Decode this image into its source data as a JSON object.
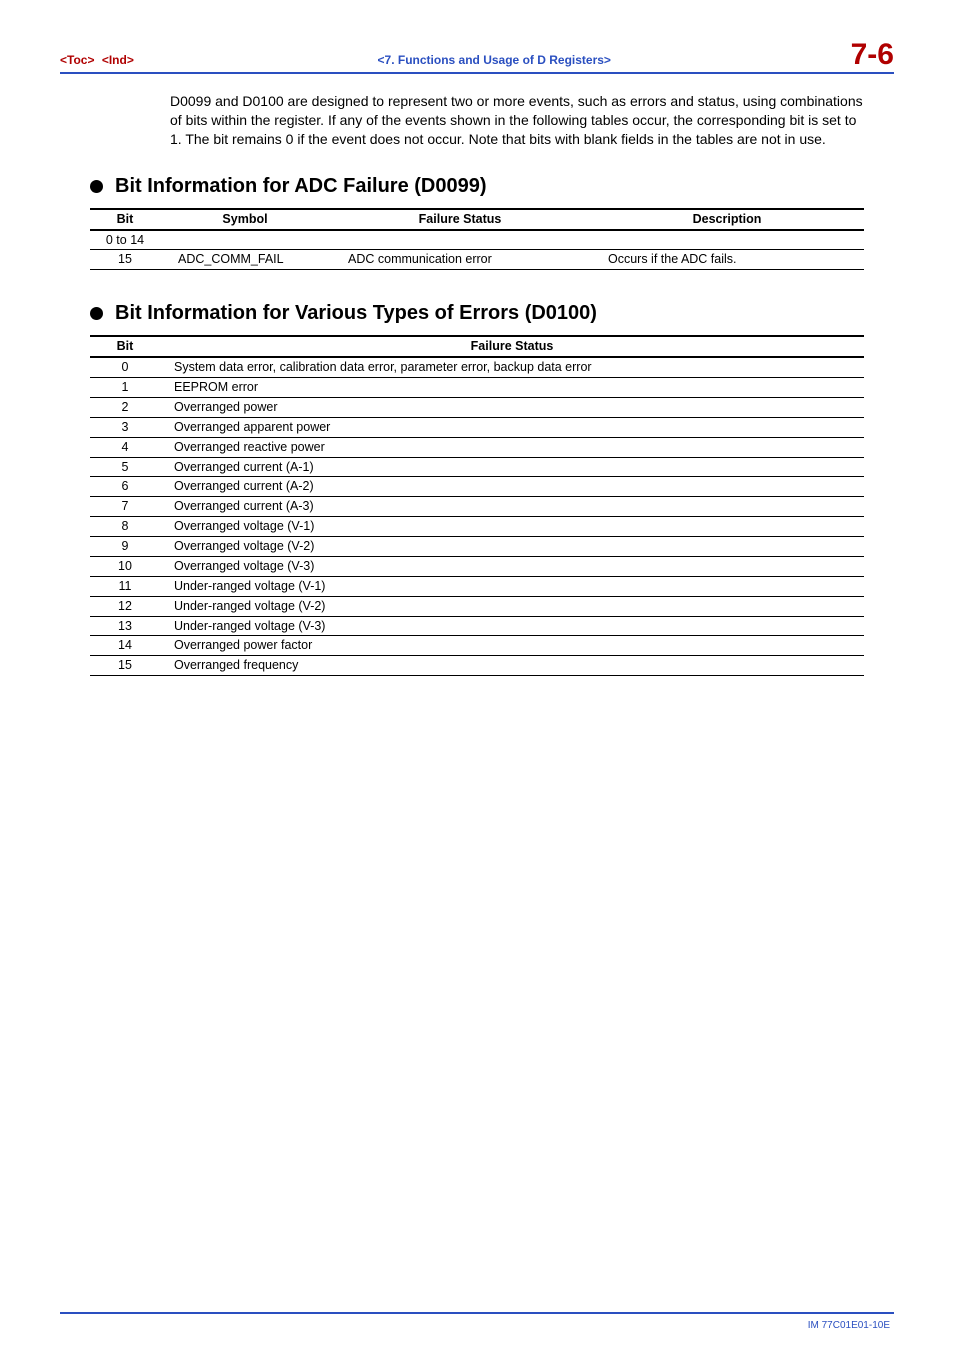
{
  "header": {
    "toc": "<Toc>",
    "ind": "<Ind>",
    "center": "<7.  Functions and Usage of D Registers>",
    "pageNum": "7-6"
  },
  "intro": "D0099 and D0100 are designed to represent two or more events, such as errors and status, using combinations of bits within the register. If any of the events shown in the following tables occur, the corresponding bit is set to 1. The bit remains 0 if the event does not occur. Note that bits with blank fields in the tables are not in use.",
  "section1": {
    "title": "Bit Information for ADC Failure (D0099)",
    "headers": {
      "bit": "Bit",
      "symbol": "Symbol",
      "failure": "Failure Status",
      "desc": "Description"
    },
    "rows": [
      {
        "bit": "0  to 14",
        "symbol": "",
        "failure": "",
        "desc": ""
      },
      {
        "bit": "15",
        "symbol": "ADC_COMM_FAIL",
        "failure": "ADC communication error",
        "desc": "Occurs if the ADC fails."
      }
    ]
  },
  "section2": {
    "title": "Bit Information for Various Types of Errors (D0100)",
    "headers": {
      "bit": "Bit",
      "failure": "Failure Status"
    },
    "rows": [
      {
        "bit": "0",
        "failure": "System data error, calibration data error, parameter error, backup data error"
      },
      {
        "bit": "1",
        "failure": "EEPROM error"
      },
      {
        "bit": "2",
        "failure": "Overranged power"
      },
      {
        "bit": "3",
        "failure": "Overranged apparent power"
      },
      {
        "bit": "4",
        "failure": "Overranged reactive power"
      },
      {
        "bit": "5",
        "failure": "Overranged current (A-1)"
      },
      {
        "bit": "6",
        "failure": "Overranged current (A-2)"
      },
      {
        "bit": "7",
        "failure": "Overranged current (A-3)"
      },
      {
        "bit": "8",
        "failure": "Overranged voltage (V-1)"
      },
      {
        "bit": "9",
        "failure": "Overranged voltage (V-2)"
      },
      {
        "bit": "10",
        "failure": "Overranged voltage (V-3)"
      },
      {
        "bit": "11",
        "failure": "Under-ranged voltage (V-1)"
      },
      {
        "bit": "12",
        "failure": "Under-ranged voltage (V-2)"
      },
      {
        "bit": "13",
        "failure": "Under-ranged voltage (V-3)"
      },
      {
        "bit": "14",
        "failure": "Overranged power factor"
      },
      {
        "bit": "15",
        "failure": "Overranged frequency"
      }
    ]
  },
  "footer": "IM 77C01E01-10E"
}
